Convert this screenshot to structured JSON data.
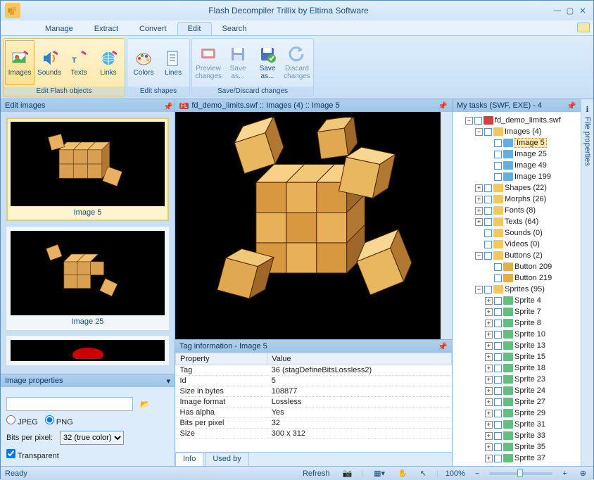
{
  "window": {
    "title": "Flash Decompiler Trillix by Eltima Software"
  },
  "menu": {
    "tabs": [
      "Manage",
      "Extract",
      "Convert",
      "Edit",
      "Search"
    ],
    "active": "Edit"
  },
  "ribbon": {
    "groups": [
      {
        "caption": "Edit Flash objects",
        "buttons": [
          {
            "label": "Images",
            "icon": "images-icon",
            "selected": true
          },
          {
            "label": "Sounds",
            "icon": "sounds-icon"
          },
          {
            "label": "Texts",
            "icon": "texts-icon"
          },
          {
            "label": "Links",
            "icon": "links-icon"
          }
        ]
      },
      {
        "caption": "Edit shapes",
        "buttons": [
          {
            "label": "Colors",
            "icon": "colors-icon"
          },
          {
            "label": "Lines",
            "icon": "lines-icon"
          }
        ]
      },
      {
        "caption": "Save/Discard changes",
        "buttons": [
          {
            "label": "Preview changes",
            "icon": "preview-icon",
            "disabled": true
          },
          {
            "label": "Save as...",
            "icon": "save-as-icon"
          },
          {
            "label": "Save as...",
            "icon": "save-as2-icon"
          },
          {
            "label": "Discard changes",
            "icon": "discard-icon",
            "disabled": true
          }
        ]
      }
    ]
  },
  "edit_images": {
    "title": "Edit images",
    "items": [
      "Image 5",
      "Image 25"
    ]
  },
  "image_properties": {
    "title": "Image properties",
    "path_value": "",
    "format_jpeg": "JPEG",
    "format_png": "PNG",
    "format_selected": "PNG",
    "bpp_label": "Bits per pixel:",
    "bpp_value": "32 (true color)",
    "transparent_label": "Transparent",
    "transparent_checked": true
  },
  "preview": {
    "breadcrumb": "fd_demo_limits.swf :: Images (4) :: Image 5"
  },
  "tag_info": {
    "title": "Tag information - Image 5",
    "headers": [
      "Property",
      "Value"
    ],
    "rows": [
      [
        "Tag",
        "36 (stagDefineBitsLossless2)"
      ],
      [
        "Id",
        "5"
      ],
      [
        "Size in bytes",
        "108877"
      ],
      [
        "Image format",
        "Lossless"
      ],
      [
        "Has alpha",
        "Yes"
      ],
      [
        "Bits per pixel",
        "32"
      ],
      [
        "Size",
        "300 x 312"
      ]
    ],
    "tabs": [
      "Info",
      "Used by"
    ]
  },
  "tasks": {
    "title": "My tasks (SWF, EXE) - 4",
    "root": "fd_demo_limits.swf",
    "images_group": "Images (4)",
    "images": [
      "Image 5",
      "Image 25",
      "Image 49",
      "Image 199"
    ],
    "shapes": "Shapes (22)",
    "morphs": "Morphs (26)",
    "fonts": "Fonts (8)",
    "texts": "Texts (64)",
    "sounds": "Sounds (0)",
    "videos": "Videos (0)",
    "buttons_group": "Buttons (2)",
    "buttons": [
      "Button 209",
      "Button 219"
    ],
    "sprites_group": "Sprites (95)",
    "sprites": [
      "Sprite 4",
      "Sprite 7",
      "Sprite 8",
      "Sprite 10",
      "Sprite 13",
      "Sprite 15",
      "Sprite 18",
      "Sprite 23",
      "Sprite 24",
      "Sprite 27",
      "Sprite 29",
      "Sprite 31",
      "Sprite 33",
      "Sprite 35",
      "Sprite 37"
    ]
  },
  "side_panel": {
    "label": "File properties"
  },
  "status": {
    "ready": "Ready",
    "refresh": "Refresh",
    "zoom": "100%"
  }
}
